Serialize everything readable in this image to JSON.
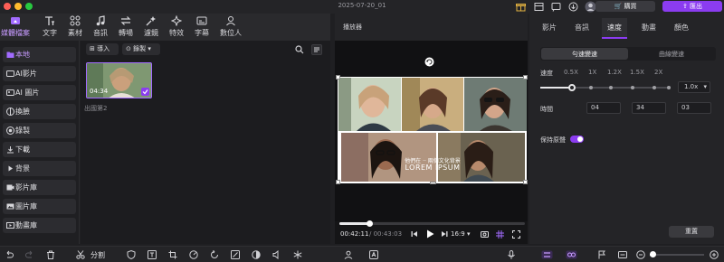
{
  "window": {
    "title": "2025-07-20_01",
    "buy_label": "購買",
    "export_label": "匯出"
  },
  "toolbar": {
    "items": [
      {
        "label": "媒體檔案",
        "icon": "media-icon"
      },
      {
        "label": "文字",
        "icon": "text-icon"
      },
      {
        "label": "素材",
        "icon": "elements-icon"
      },
      {
        "label": "音訊",
        "icon": "audio-icon"
      },
      {
        "label": "轉場",
        "icon": "transition-icon"
      },
      {
        "label": "濾鏡",
        "icon": "filter-icon"
      },
      {
        "label": "特效",
        "icon": "effects-icon"
      },
      {
        "label": "字幕",
        "icon": "subtitle-icon"
      },
      {
        "label": "數位人",
        "icon": "avatar-icon"
      }
    ]
  },
  "sidebar": {
    "items": [
      {
        "label": "本地",
        "active": true
      },
      {
        "label": "AI影片"
      },
      {
        "label": "AI 圖片"
      },
      {
        "label": "換臉"
      },
      {
        "label": "錄製"
      },
      {
        "label": "下載"
      },
      {
        "label": "背景"
      },
      {
        "label": "影片庫"
      },
      {
        "label": "圖片庫"
      },
      {
        "label": "動畫庫"
      }
    ]
  },
  "media": {
    "import_label": "導入",
    "record_label": "錄製",
    "thumb_duration": "04:34",
    "thumb_name": "出國第2"
  },
  "player": {
    "title": "播放器",
    "caption_line1": "他們在 ·· 兩個文化背景",
    "caption_line2": "LOREM IPSUM",
    "time_current": "00:42:11",
    "time_total": "/ 00:43:03",
    "progress": 0.16,
    "aspect": "16:9"
  },
  "panel": {
    "tabs": [
      "影片",
      "音訊",
      "速度",
      "動畫",
      "顏色"
    ],
    "active_tab": 2,
    "seg_left": "勻速變速",
    "seg_right": "曲線變速",
    "speed_label": "速度",
    "speed_ticks": [
      "0.5X",
      "1X",
      "1.2X",
      "1.5X",
      "2X"
    ],
    "speed_value": "1.0x",
    "speed_level": 0.24,
    "time_label": "時間",
    "time_h": "04",
    "time_m": "34",
    "time_s": "03",
    "keep_pitch_label": "保持原聲",
    "reset_label": "重置"
  },
  "bottombar": {
    "split_label": "分割",
    "zoom_level": 0.05
  }
}
